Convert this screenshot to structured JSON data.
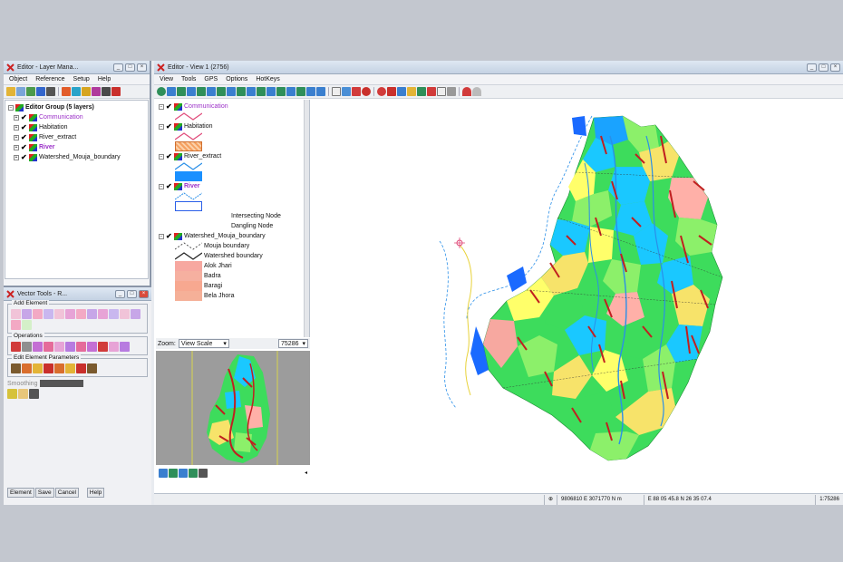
{
  "layer_manager": {
    "title": "Editor - Layer Mana...",
    "menu": [
      "Object",
      "Reference",
      "Setup",
      "Help"
    ],
    "group_label": "Editor Group (5 layers)",
    "layers": [
      {
        "name": "Communication",
        "color": "#9b30c8"
      },
      {
        "name": "Habitation",
        "color": "#111111"
      },
      {
        "name": "River_extract",
        "color": "#111111"
      },
      {
        "name": "River",
        "color": "#9b30c8"
      },
      {
        "name": "Watershed_Mouja_boundary",
        "color": "#111111"
      }
    ]
  },
  "vector_tools": {
    "title": "Vector Tools - R...",
    "add_element_label": "Add Element",
    "operations_label": "Operations",
    "edit_params_label": "Edit Element Parameters",
    "smoothing_label": "Smoothing",
    "tabs": [
      "Element",
      "Save",
      "Cancel",
      "Help"
    ]
  },
  "view": {
    "title": "Editor - View 1 (2756)",
    "menu": [
      "View",
      "Tools",
      "GPS",
      "Options",
      "HotKeys"
    ],
    "legend": {
      "communication": "Communication",
      "habitation": "Habitation",
      "river_extract": "River_extract",
      "river": "River",
      "intersecting_node": "Intersecting Node",
      "dangling_node": "Dangling Node",
      "watershed": "Watershed_Mouja_boundary",
      "mouja_boundary": "Mouja boundary",
      "watershed_boundary": "Watershed boundary",
      "classes": [
        "Alok Jhari",
        "Badra",
        "Baragi",
        "Bela Jhora"
      ]
    },
    "zoom_label": "Zoom:",
    "zoom_value": "View Scale",
    "scale_value": "75286",
    "status": {
      "coords": "9806810 E 3071770 N m",
      "latlon": "E 88 05 45.8 N 26 35 07.4",
      "scale": "1:75286"
    }
  },
  "colors": {
    "communication": "#e04a7a",
    "habitation": "#f5a060",
    "river": "#2a8fe8",
    "mouja": "#f7a8a0"
  }
}
